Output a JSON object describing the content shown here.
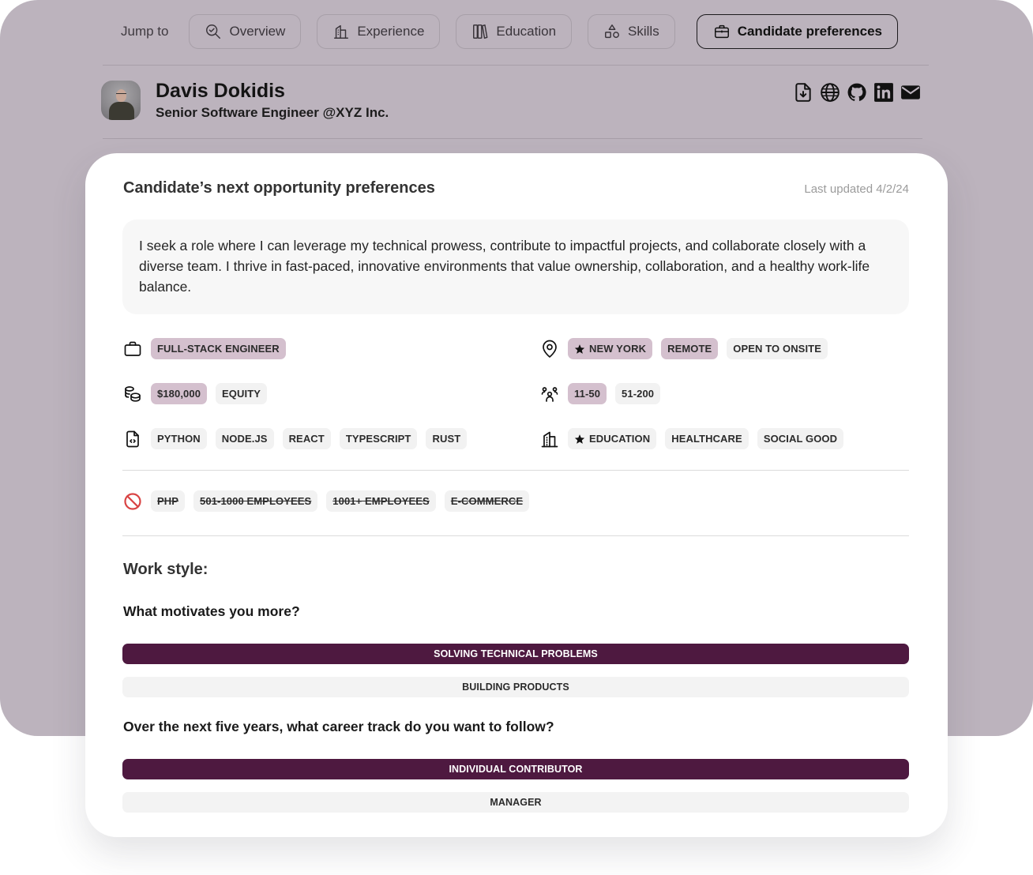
{
  "jump_nav": {
    "label": "Jump to",
    "items": [
      {
        "label": "Overview",
        "icon": "search-check-icon",
        "active": false
      },
      {
        "label": "Experience",
        "icon": "building-icon",
        "active": false
      },
      {
        "label": "Education",
        "icon": "books-icon",
        "active": false
      },
      {
        "label": "Skills",
        "icon": "shapes-icon",
        "active": false
      },
      {
        "label": "Candidate preferences",
        "icon": "briefcase-icon",
        "active": true
      }
    ]
  },
  "profile": {
    "name": "Davis Dokidis",
    "title": "Senior Software Engineer @XYZ Inc.",
    "links": [
      "resume-download-icon",
      "website-globe-icon",
      "github-icon",
      "linkedin-icon",
      "email-icon"
    ]
  },
  "card": {
    "title": "Candidate’s next opportunity preferences",
    "last_updated": "Last updated 4/2/24",
    "summary": "I seek a role where I can leverage my technical prowess, contribute to impactful projects, and collaborate closely with a diverse team. I thrive in fast-paced, innovative environments that value ownership, collaboration, and a healthy work-life balance.",
    "roles": [
      {
        "label": "FULL-STACK ENGINEER",
        "highlight": true
      }
    ],
    "compensation": [
      {
        "label": "$180,000",
        "highlight": true
      },
      {
        "label": "EQUITY",
        "highlight": false
      }
    ],
    "tech": [
      {
        "label": "PYTHON"
      },
      {
        "label": "NODE.JS"
      },
      {
        "label": "REACT"
      },
      {
        "label": "TYPESCRIPT"
      },
      {
        "label": "RUST"
      }
    ],
    "locations": [
      {
        "label": "NEW YORK",
        "highlight": true,
        "starred": true
      },
      {
        "label": "REMOTE",
        "highlight": true
      },
      {
        "label": "OPEN TO ONSITE",
        "highlight": false
      }
    ],
    "company_sizes": [
      {
        "label": "11-50",
        "highlight": true
      },
      {
        "label": "51-200",
        "highlight": false
      }
    ],
    "industries": [
      {
        "label": "EDUCATION",
        "starred": true
      },
      {
        "label": "HEALTHCARE"
      },
      {
        "label": "SOCIAL GOOD"
      }
    ],
    "exclusions": [
      {
        "label": "PHP"
      },
      {
        "label": "501-1000 EMPLOYEES"
      },
      {
        "label": "1001+ EMPLOYEES"
      },
      {
        "label": "E-COMMERCE"
      }
    ],
    "work_style": {
      "heading": "Work style:",
      "questions": [
        {
          "question": "What motivates you more?",
          "options": [
            {
              "label": "SOLVING TECHNICAL PROBLEMS",
              "selected": true
            },
            {
              "label": "BUILDING PRODUCTS",
              "selected": false
            }
          ]
        },
        {
          "question": "Over the next five years, what career track do you want to follow?",
          "options": [
            {
              "label": "INDIVIDUAL CONTRIBUTOR",
              "selected": true
            },
            {
              "label": "MANAGER",
              "selected": false
            }
          ]
        }
      ]
    }
  },
  "colors": {
    "background_panel": "#bcb3bd",
    "highlight_chip": "#d4c0ce",
    "selected_option": "#4e1940",
    "exclusion_icon": "#d94444"
  }
}
